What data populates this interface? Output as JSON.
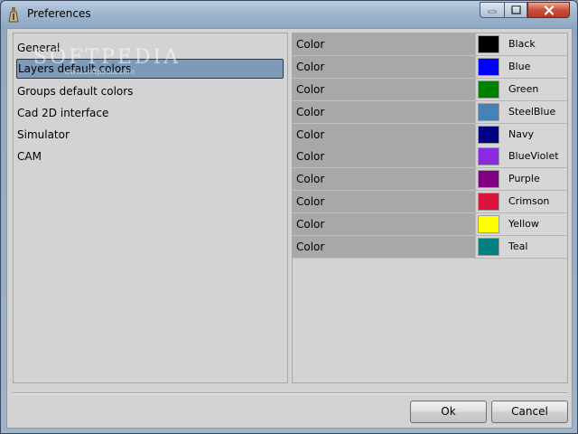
{
  "window": {
    "title": "Preferences",
    "controls": {
      "minimize_icon": "minimize-icon",
      "maximize_icon": "maximize-icon",
      "close_icon": "close-icon"
    }
  },
  "watermark": {
    "text": "SOFTPEDIA",
    "sub": "www.softpedia.com"
  },
  "nav": {
    "items": [
      {
        "label": "General",
        "selected": false
      },
      {
        "label": "Layers default colors",
        "selected": true
      },
      {
        "label": "Groups default colors",
        "selected": false
      },
      {
        "label": "Cad 2D interface",
        "selected": false
      },
      {
        "label": "Simulator",
        "selected": false
      },
      {
        "label": "CAM",
        "selected": false
      }
    ]
  },
  "properties": {
    "rows": [
      {
        "label": "Color",
        "value": "Black",
        "swatch": "#000000"
      },
      {
        "label": "Color",
        "value": "Blue",
        "swatch": "#0000ff"
      },
      {
        "label": "Color",
        "value": "Green",
        "swatch": "#008000"
      },
      {
        "label": "Color",
        "value": "SteelBlue",
        "swatch": "#4682b4"
      },
      {
        "label": "Color",
        "value": "Navy",
        "swatch": "#000080"
      },
      {
        "label": "Color",
        "value": "BlueViolet",
        "swatch": "#8a2be2"
      },
      {
        "label": "Color",
        "value": "Purple",
        "swatch": "#800080"
      },
      {
        "label": "Color",
        "value": "Crimson",
        "swatch": "#dc143c"
      },
      {
        "label": "Color",
        "value": "Yellow",
        "swatch": "#ffff00"
      },
      {
        "label": "Color",
        "value": "Teal",
        "swatch": "#008080"
      }
    ]
  },
  "buttons": {
    "ok": "Ok",
    "cancel": "Cancel"
  }
}
